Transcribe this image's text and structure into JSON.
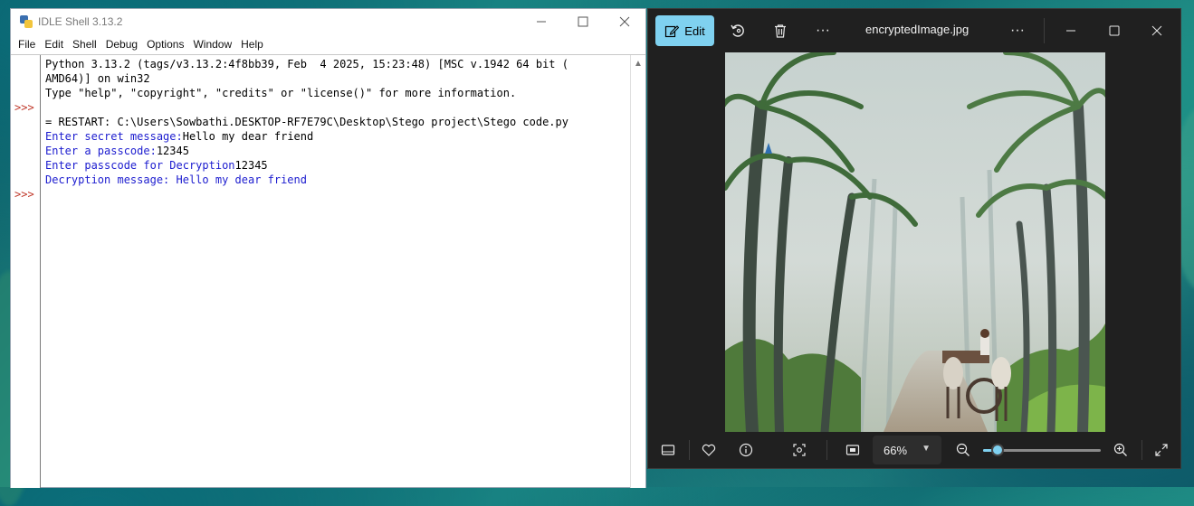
{
  "idle": {
    "title": "IDLE Shell 3.13.2",
    "menu": [
      "File",
      "Edit",
      "Shell",
      "Debug",
      "Options",
      "Window",
      "Help"
    ],
    "prompt": ">>>",
    "lines": [
      "Python 3.13.2 (tags/v3.13.2:4f8bb39, Feb  4 2025, 15:23:48) [MSC v.1942 64 bit (",
      "AMD64)] on win32",
      "Type \"help\", \"copyright\", \"credits\" or \"license()\" for more information.",
      "",
      "= RESTART: C:\\Users\\Sowbathi.DESKTOP-RF7E79C\\Desktop\\Stego project\\Stego code.py",
      "Enter secret message:",
      "Hello my dear friend",
      "Enter a passcode:",
      "12345",
      "Enter passcode for Decryption",
      "12345",
      "Decryption message: Hello my dear friend"
    ]
  },
  "photos": {
    "edit_label": "Edit",
    "filename": "encryptedImage.jpg",
    "more_label": "···",
    "zoom": "66%",
    "zoom_level_percent": 12,
    "accent": "#7fd1f0"
  }
}
